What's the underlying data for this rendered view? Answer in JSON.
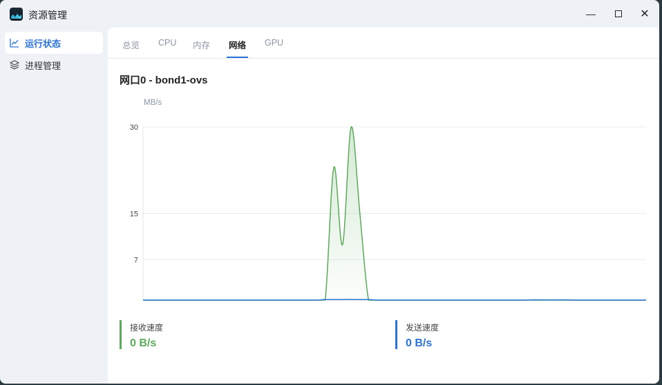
{
  "window": {
    "title": "资源管理",
    "controls": [
      "minimize",
      "maximize",
      "close"
    ]
  },
  "sidebar": {
    "items": [
      {
        "label": "运行状态",
        "icon": "line-chart-icon",
        "active": true
      },
      {
        "label": "进程管理",
        "icon": "layers-icon",
        "active": false
      }
    ]
  },
  "tabs": [
    {
      "label": "总览"
    },
    {
      "label": "CPU"
    },
    {
      "label": "内存"
    },
    {
      "label": "网络",
      "active": true
    },
    {
      "label": "GPU"
    }
  ],
  "section_title": "网口0 - bond1-ovs",
  "colors": {
    "accent": "#2a73d9",
    "receive": "#5aaa5a",
    "send": "#2a73d9"
  },
  "chart_data": {
    "type": "area",
    "ylabel": "MB/s",
    "yticks": [
      30,
      15,
      7
    ],
    "ylim": [
      0,
      30
    ],
    "grid": true,
    "series": [
      {
        "name": "接收速度",
        "color": "#5aaa5a",
        "values": [
          0,
          0,
          0,
          0,
          0,
          0,
          0,
          0,
          0,
          0,
          0,
          0,
          0,
          0,
          0,
          0,
          0,
          0,
          0,
          0,
          0,
          0,
          23,
          9.6,
          30,
          15,
          0,
          0,
          0,
          0,
          0,
          0,
          0,
          0,
          0,
          0,
          0,
          0,
          0,
          0,
          0,
          0,
          0,
          0,
          0,
          0,
          0,
          0,
          0,
          0,
          0,
          0,
          0,
          0,
          0,
          0,
          0,
          0,
          0
        ]
      },
      {
        "name": "发送速度",
        "color": "#2a73d9",
        "values": [
          0,
          0,
          0,
          0,
          0,
          0,
          0,
          0,
          0,
          0,
          0,
          0,
          0,
          0,
          0,
          0,
          0,
          0,
          0,
          0,
          0,
          0.1,
          0.1,
          0.1,
          0.12,
          0.1,
          0.1,
          0,
          0,
          0,
          0,
          0,
          0,
          0,
          0,
          0,
          0,
          0,
          0,
          0,
          0,
          0,
          0,
          0,
          0,
          0.05,
          0.05,
          0.05,
          0.05,
          0.05,
          0,
          0,
          0,
          0,
          0,
          0,
          0,
          0,
          0
        ]
      }
    ]
  },
  "stats": {
    "receive": {
      "label": "接收速度",
      "value": "0 B/s"
    },
    "send": {
      "label": "发送速度",
      "value": "0 B/s"
    }
  }
}
